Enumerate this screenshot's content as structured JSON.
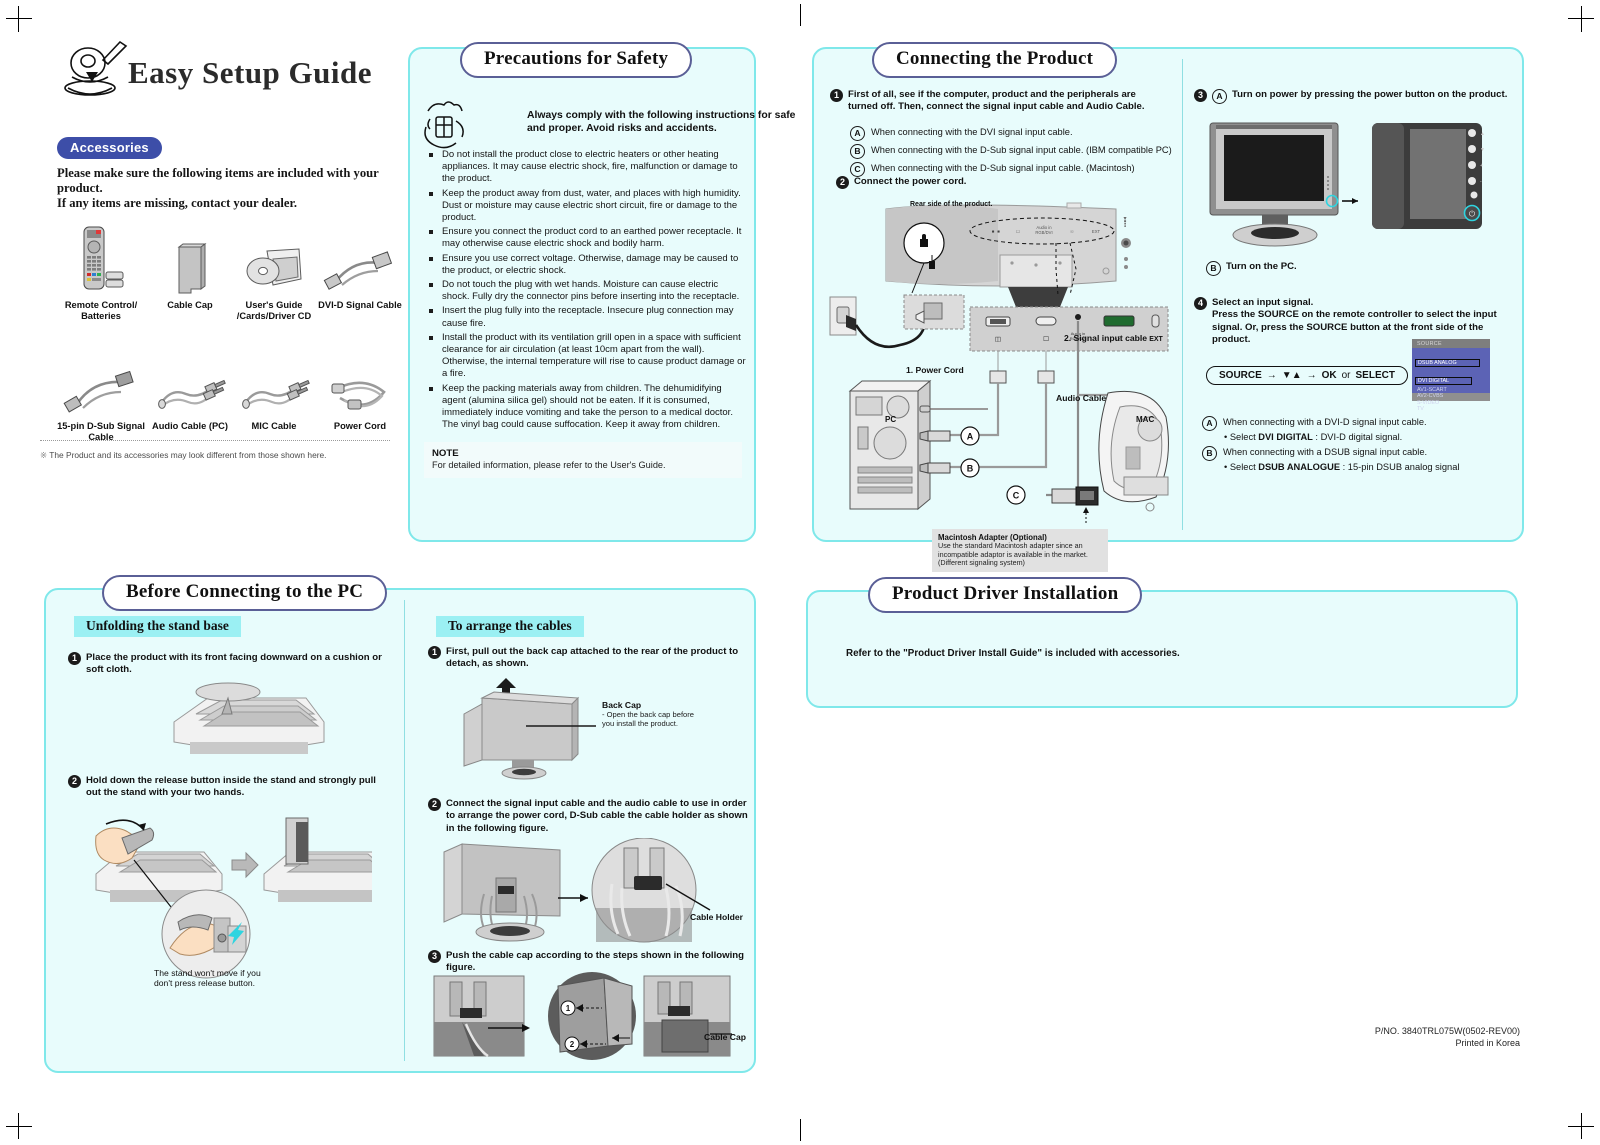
{
  "document": {
    "title": "Easy Setup Guide",
    "footer_partno": "P/NO. 3840TRL075W(0502-REV00)",
    "footer_printed": "Printed in Korea"
  },
  "accessories": {
    "badge": "Accessories",
    "description": "Please make sure the following items are included with your product.\nIf any items are missing, contact your dealer.",
    "items": [
      {
        "label": "Remote Control/\nBatteries",
        "icon": "remote-control-icon"
      },
      {
        "label": "Cable Cap",
        "icon": "cable-cap-icon"
      },
      {
        "label": "User's Guide\n/Cards/Driver CD",
        "icon": "cd-guide-icon"
      },
      {
        "label": "DVI-D Signal Cable",
        "icon": "dvi-cable-icon"
      },
      {
        "label": "15-pin D-Sub Signal\nCable",
        "icon": "dsub-cable-icon"
      },
      {
        "label": "Audio Cable (PC)",
        "icon": "audio-cable-icon"
      },
      {
        "label": "MIC Cable",
        "icon": "mic-cable-icon"
      },
      {
        "label": "Power Cord",
        "icon": "power-cord-icon"
      }
    ],
    "footnote": "The Product and its accessories may look different from those shown here."
  },
  "precautions": {
    "title": "Precautions for Safety",
    "warning": "Always comply with the following instructions for safe and proper.  Avoid risks and accidents.",
    "items": [
      "Do not install the product close to electric heaters or other heating appliances. It may cause electric shock, fire, malfunction or damage to the product.",
      "Keep the product away from dust, water, and places with high humidity. Dust or moisture may cause electric short circuit, fire or damage to the product.",
      "Ensure you connect the product cord to an earthed power receptacle. It may otherwise cause electric shock and bodily harm.",
      "Ensure you use correct voltage. Otherwise, damage may be caused to the product, or electric shock.",
      "Do not touch the plug with wet hands. Moisture can cause electric shock. Fully dry the connector pins before inserting into the receptacle.",
      "Insert the plug fully into the receptacle. Insecure plug connection may cause fire.",
      "Install the product with its ventilation grill open in a space with sufficient clearance for air circulation (at least 10cm apart from the wall). Otherwise, the internal temperature will rise to cause product damage or a fire.",
      "Keep the packing materials away from children. The dehumidifying agent (alumina silica gel) should not be eaten. If it is consumed, immediately induce vomiting and take the person to a medical doctor. The vinyl bag could cause suffocation. Keep it away from children."
    ],
    "note_title": "NOTE",
    "note_body": "For detailed information, please refer to the User's Guide."
  },
  "connecting": {
    "title": "Connecting the Product",
    "step1_num": "1",
    "step1": "First of all, see if the computer, product and the peripherals are turned off. Then, connect the signal input cable and Audio Cable.",
    "step1_subs": [
      {
        "letter": "A",
        "text": "When connecting with the DVI signal input cable."
      },
      {
        "letter": "B",
        "text": "When connecting with the D-Sub signal input cable. (IBM compatible PC)"
      },
      {
        "letter": "C",
        "text": "When connecting with the D-Sub signal input cable. (Macintosh)"
      }
    ],
    "step2_num": "2",
    "step2": "Connect the power cord.",
    "diagram": {
      "rear_label": "Rear side of the product.",
      "power_cord_label": "1. Power Cord",
      "signal_cable_label": "2. Signal input cable",
      "audio_cable_label": "Audio Cable",
      "pc_label": "PC",
      "mac_label": "MAC",
      "port_ext": "EXT",
      "port_audio": "Audio in\nRGB/DVI",
      "mac_adapter_title": "Macintosh Adapter (Optional)",
      "mac_adapter_body": "Use the standard Macintosh adapter since an incompatible adaptor is available in the market. (Different signaling system)"
    },
    "step3_num": "3",
    "step3_letter": "A",
    "step3": "Turn on power by pressing the power button on the product.",
    "step3b_letter": "B",
    "step3b": "Turn on the PC.",
    "step4_num": "4",
    "step4_title": "Select an input signal.",
    "step4_body": "Press the SOURCE on the remote controller to select the input signal. Or, press the SOURCE button at the front side of the product.",
    "source_pill": {
      "source": "SOURCE",
      "arrows": "▼▲",
      "ok": "OK",
      "or": "or",
      "select": "SELECT"
    },
    "osd": {
      "header": "SOURCE",
      "items": [
        "DSUB ANALOG",
        "DVI DIGITAL",
        "AV1-SCART",
        "AV2-CVBS",
        "S-VIDEO",
        "TV"
      ],
      "selected_index": 1
    },
    "step4_subs": [
      {
        "letter": "A",
        "text": "When connecting with a DVI-D signal input cable.",
        "bullet_bold": "DVI DIGITAL",
        "bullet_prefix": "• Select ",
        "bullet_suffix": " : DVI-D digital signal."
      },
      {
        "letter": "B",
        "text": "When connecting with a DSUB signal input cable.",
        "bullet_bold": "DSUB ANALOGUE",
        "bullet_prefix": "• Select ",
        "bullet_suffix": " : 15-pin DSUB analog signal"
      }
    ]
  },
  "before_connecting": {
    "title": "Before Connecting to the PC",
    "left_head": "Unfolding the stand base",
    "left_step1_num": "1",
    "left_step1": "Place the product with its front facing downward on a cushion or soft cloth.",
    "left_step2_num": "2",
    "left_step2": "Hold down the release button inside the stand and strongly pull out the stand with your two hands.",
    "left_caption": "The stand won't move if you\ndon't press release button.",
    "right_head": "To arrange the cables",
    "right_step1_num": "1",
    "right_step1": "First, pull out the back cap attached to the rear of the product to detach, as shown.",
    "back_cap_label": "Back Cap",
    "back_cap_sub": "- Open the back cap before\n  you install the product.",
    "right_step2_num": "2",
    "right_step2": "Connect the signal input cable and the audio cable to use in order to arrange the power cord, D-Sub cable the cable holder as shown in the following figure.",
    "cable_holder_label": "Cable Holder",
    "right_step3_num": "3",
    "right_step3": "Push the cable cap according to the steps shown in the following figure.",
    "cable_cap_label": "Cable Cap",
    "cap_step1": "1",
    "cap_step2": "2"
  },
  "driver": {
    "title": "Product Driver Installation",
    "body": "Refer to the \"Product Driver Install Guide\" is included with accessories."
  },
  "colors": {
    "panel_bg": "#e8fcfc",
    "panel_border": "#7fe8ea",
    "title_border": "#5a5f96",
    "badge": "#3d4ea8",
    "subhead": "#9bf0f3"
  }
}
